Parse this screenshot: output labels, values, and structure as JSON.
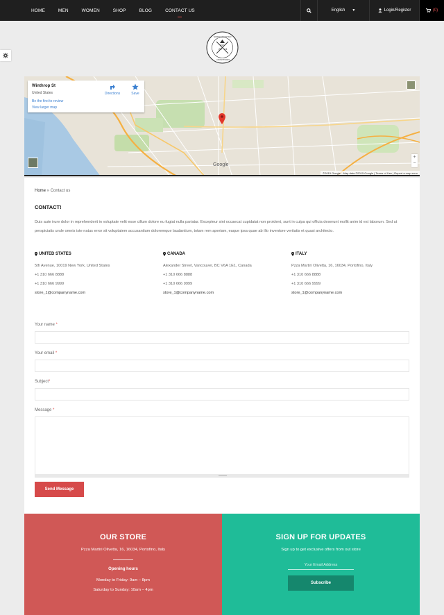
{
  "nav": {
    "items": [
      {
        "label": "HOME"
      },
      {
        "label": "MEN"
      },
      {
        "label": "WOMEN"
      },
      {
        "label": "SHOP"
      },
      {
        "label": "BLOG"
      },
      {
        "label": "CONTACT US"
      }
    ],
    "active": "CONTACT US",
    "language": "English",
    "login": "Login/Register",
    "cart_count": "(0)"
  },
  "logo": {
    "text_top": "NORTH MOUNTAIN",
    "text_bottom": "ADVENTURES",
    "year_left": "20",
    "year_right": "14",
    "center": "EST."
  },
  "map": {
    "place_title": "Winthrop St",
    "place_sub": "United States",
    "review_link": "Be the first to review",
    "larger_link": "View larger map",
    "directions_label": "Directions",
    "save_label": "Save",
    "google_label": "Google",
    "footer_text": "©2015 Google - Map data ©2015 Google  |  Terms of Use  |  Report a map error",
    "labels": [
      "Brooklyn Museum",
      "Brooklyn Children's Museum",
      "Prospect Park",
      "PROSPECT LEFFERTS GARDENS",
      "Green-Wood Cemetery",
      "FLATBUSH",
      "EAST FLATBUSH",
      "CROWN HEIGHTS",
      "EAST NEW YORK",
      "Spring Creek",
      "Church Ave",
      "Clarkson Ave",
      "Empire Blvd",
      "Linden Blvd",
      "Fort Hamilton Pkwy",
      "Bay Ridge Pkwy",
      "KENSINGTON",
      "CANARSIE",
      "WINDSOR TERRACE",
      "PARK SLOPE"
    ]
  },
  "breadcrumb": {
    "home": "Home",
    "separator": " » ",
    "current": "Contact us"
  },
  "contact": {
    "title": "CONTACT!",
    "intro": "Duis aute irure dolor in reprehenderit in voluptate velit esse cillum dolore eu fugiat nulla pariatur. Excepteur sint occaecat cupidatat non proident, sunt in culpa qui officia deserunt mollit anim id est laborum. Sed ut perspiciatis unde omnis iste natus error sit voluptatem accusantium doloremque laudantium, totam rem aperiam, eaque ipsa quae ab illo inventore veritatis et quasi architecto.",
    "offices": [
      {
        "name": "UNITED STATES",
        "address": "5th Avenue, 10019 New York, United States",
        "phone1": "+1 310 666 8888",
        "phone2": "+1 310 666 9999",
        "email": "store_1@companyname.com"
      },
      {
        "name": "CANADA",
        "address": "Alexander Street, Vancouver, BC V6A 1E1, Canada",
        "phone1": "+1 310 666 8888",
        "phone2": "+1 310 666 9999",
        "email": "store_1@companyname.com"
      },
      {
        "name": "ITALY",
        "address": "Pzza Martiri Olivetta, 16, 16034, Portofino, Italy",
        "phone1": "+1 310 666 8888",
        "phone2": "+1 310 666 9999",
        "email": "store_1@companyname.com"
      }
    ]
  },
  "form": {
    "name_label": "Your name",
    "email_label": "Your email",
    "subject_label": "Subject",
    "message_label": "Message",
    "required_mark": "*",
    "submit_label": "Send Message"
  },
  "footer": {
    "store": {
      "title": "OUR STORE",
      "address": "Pzza Martiri Olivetta, 16, 16034, Portofino, Italy",
      "hours_title": "Opening hours",
      "hours_weekdays": "Monday to Friday: 9am – 8pm",
      "hours_weekend": "Saturday to Sunday: 10am – 4pm"
    },
    "signup": {
      "title": "SIGN UP FOR UPDATES",
      "subtitle": "Sign up to get exclusive offers from out store",
      "email_placeholder": "Your Email Address",
      "button_label": "Subscribe"
    }
  },
  "colors": {
    "accent_red": "#d64a4a",
    "store_bg": "#d05856",
    "signup_bg": "#1fbc98",
    "subscribe_btn": "#15876d",
    "topbar": "#1f1f1f"
  }
}
